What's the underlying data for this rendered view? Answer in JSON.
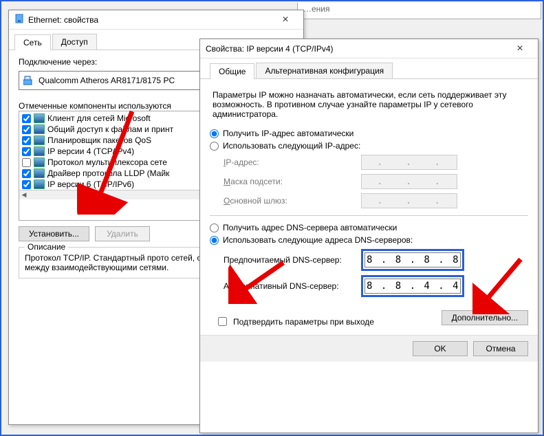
{
  "bg_window": {
    "title_fragment": "…ения"
  },
  "ethernet_window": {
    "title": "Ethernet: свойства",
    "tabs": {
      "network": "Сеть",
      "access": "Доступ"
    },
    "connect_via_label": "Подключение через:",
    "adapter_name": "Qualcomm Atheros AR8171/8175 PC",
    "components_label": "Отмеченные компоненты используются",
    "items": [
      {
        "checked": true,
        "label": "Клиент для сетей Microsoft"
      },
      {
        "checked": true,
        "label": "Общий доступ к файлам и принт"
      },
      {
        "checked": true,
        "label": "Планировщик пакетов QoS"
      },
      {
        "checked": true,
        "label": "IP версии 4 (TCP/IPv4)"
      },
      {
        "checked": false,
        "label": "Протокол мультиплексора сете"
      },
      {
        "checked": true,
        "label": "Драйвер протокола LLDP (Майк"
      },
      {
        "checked": true,
        "label": "IP версии 6 (TCP/IPv6)"
      }
    ],
    "install_btn": "Установить...",
    "remove_btn": "Удалить",
    "description_legend": "Описание",
    "description_text": "Протокол TCP/IP. Стандартный прото сетей, обеспечивающий связь между взаимодействующими сетями."
  },
  "ipv4_window": {
    "title": "Свойства: IP версии 4 (TCP/IPv4)",
    "tabs": {
      "general": "Общие",
      "alt": "Альтернативная конфигурация"
    },
    "intro_text": "Параметры IP можно назначать автоматически, если сеть поддерживает эту возможность. В противном случае узнайте параметры IP у сетевого администратора.",
    "ip_auto_label": "Получить IP-адрес автоматически",
    "ip_manual_label": "Использовать следующий IP-адрес:",
    "ip_address_label": "IP-адрес:",
    "subnet_label": "Маска подсети:",
    "gateway_label": "Основной шлюз:",
    "ip_address_value": ".   .   .",
    "subnet_value": ".   .   .",
    "gateway_value": ".   .   .",
    "dns_auto_label": "Получить адрес DNS-сервера автоматически",
    "dns_manual_label": "Использовать следующие адреса DNS-серверов:",
    "dns_preferred_label": "Предпочитаемый DNS-сервер:",
    "dns_alternate_label": "Альтернативный DNS-сервер:",
    "dns_preferred_value": "8 . 8 . 8 . 8",
    "dns_alternate_value": "8 . 8 . 4 . 4",
    "validate_checkbox_label": "Подтвердить параметры при выходе",
    "advanced_btn": "Дополнительно...",
    "ok_btn": "OK",
    "cancel_btn": "Отмена"
  }
}
